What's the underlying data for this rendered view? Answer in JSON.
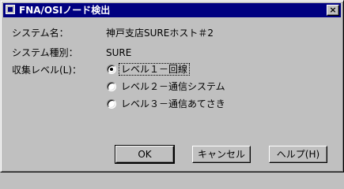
{
  "window": {
    "title": "FNA/OSIノード検出",
    "close_glyph": "×"
  },
  "fields": {
    "system_name_label": "システム名：",
    "system_name_value": "神戸支店SUREホスト＃2",
    "system_type_label": "システム種別：",
    "system_type_value": "SURE",
    "collect_level_label": "収集レベル(L)："
  },
  "radios": [
    {
      "label": "レベル１－回線",
      "checked": true
    },
    {
      "label": "レベル２－通信システム",
      "checked": false
    },
    {
      "label": "レベル３－通信あてさき",
      "checked": false
    }
  ],
  "buttons": {
    "ok": "OK",
    "cancel": "キャンセル",
    "help": "ヘルプ(H)"
  },
  "icons": {
    "window_icon": "app-window-icon",
    "close": "close-icon"
  }
}
